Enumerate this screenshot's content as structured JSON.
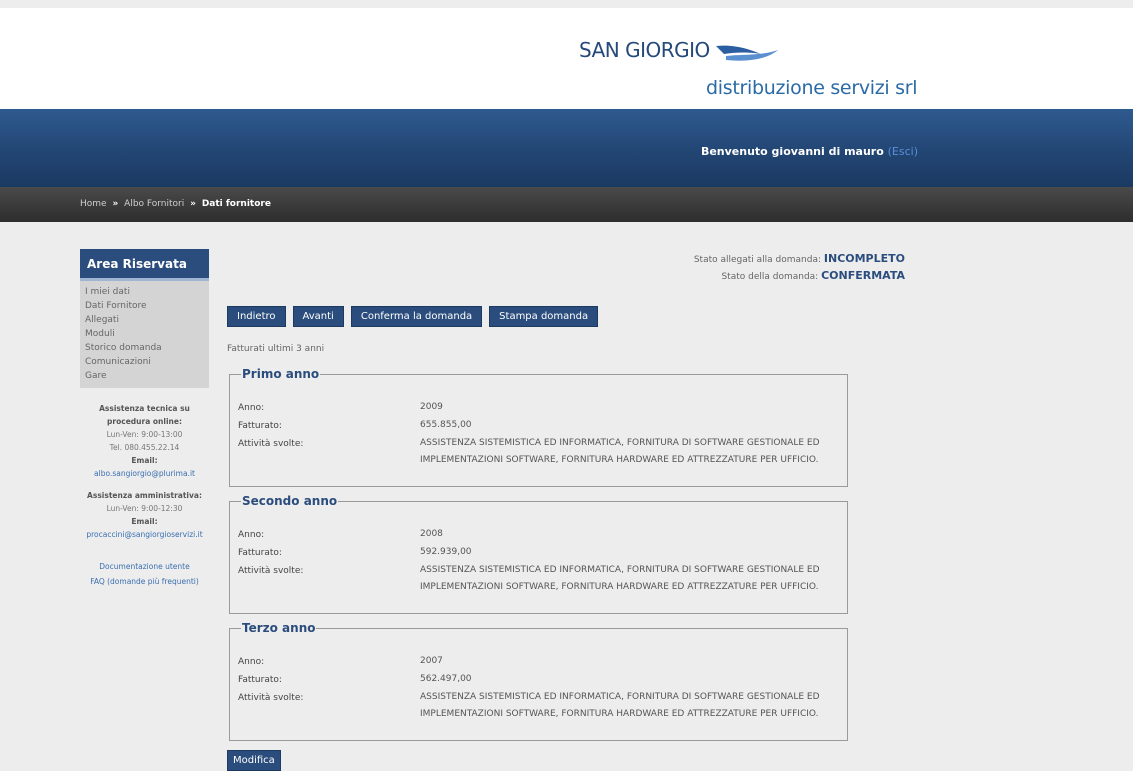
{
  "header": {
    "logo_main": "SAN GIORGIO",
    "logo_sub": "distribuzione servizi srl",
    "welcome": "Benvenuto giovanni di mauro",
    "logout": "(Esci)"
  },
  "breadcrumb": {
    "home": "Home",
    "albo": "Albo Fornitori",
    "current": "Dati fornitore",
    "separator": "»"
  },
  "sidebar": {
    "title": "Area Riservata",
    "items": [
      {
        "label": "I miei dati"
      },
      {
        "label": "Dati Fornitore"
      },
      {
        "label": "Allegati"
      },
      {
        "label": "Moduli"
      },
      {
        "label": "Storico domanda"
      },
      {
        "label": "Comunicazioni"
      },
      {
        "label": "Gare"
      }
    ],
    "support_tech_title_1": "Assistenza tecnica su",
    "support_tech_title_2": "procedura online:",
    "support_tech_hours": "Lun-Ven: 9:00-13:00",
    "support_tech_tel": "Tel. 080.455.22.14",
    "support_tech_email_label": "Email:",
    "support_tech_email": "albo.sangiorgio@plurima.it",
    "support_admin_title": "Assistenza amministrativa:",
    "support_admin_hours": "Lun-Ven: 9:00-12:30",
    "support_admin_email_label": "Email:",
    "support_admin_email": "procaccini@sangiorgioservizi.it",
    "docs_link": "Documentazione utente",
    "faq_link": "FAQ (domande più frequenti)"
  },
  "status": {
    "attachments_label": "Stato allegati alla domanda:",
    "attachments_value": "INCOMPLETO",
    "application_label": "Stato della domanda:",
    "application_value": "CONFERMATA"
  },
  "toolbar": {
    "back": "Indietro",
    "next": "Avanti",
    "confirm": "Conferma la domanda",
    "print": "Stampa domanda"
  },
  "section_title": "Fatturati ultimi 3 anni",
  "labels": {
    "anno": "Anno:",
    "fatturato": "Fatturato:",
    "attivita": "Attività svolte:"
  },
  "years": [
    {
      "legend": "Primo anno",
      "anno": "2009",
      "fatturato": "655.855,00",
      "attivita": "ASSISTENZA SISTEMISTICA ED INFORMATICA, FORNITURA DI SOFTWARE GESTIONALE ED IMPLEMENTAZIONI SOFTWARE, FORNITURA HARDWARE ED ATTREZZATURE PER UFFICIO."
    },
    {
      "legend": "Secondo anno",
      "anno": "2008",
      "fatturato": "592.939,00",
      "attivita": "ASSISTENZA SISTEMISTICA ED INFORMATICA, FORNITURA DI SOFTWARE GESTIONALE ED IMPLEMENTAZIONI SOFTWARE, FORNITURA HARDWARE ED ATTREZZATURE PER UFFICIO."
    },
    {
      "legend": "Terzo anno",
      "anno": "2007",
      "fatturato": "562.497,00",
      "attivita": "ASSISTENZA SISTEMISTICA ED INFORMATICA, FORNITURA DI SOFTWARE GESTIONALE ED IMPLEMENTAZIONI SOFTWARE, FORNITURA HARDWARE ED ATTREZZATURE PER UFFICIO."
    }
  ],
  "modify_button": "Modifica"
}
